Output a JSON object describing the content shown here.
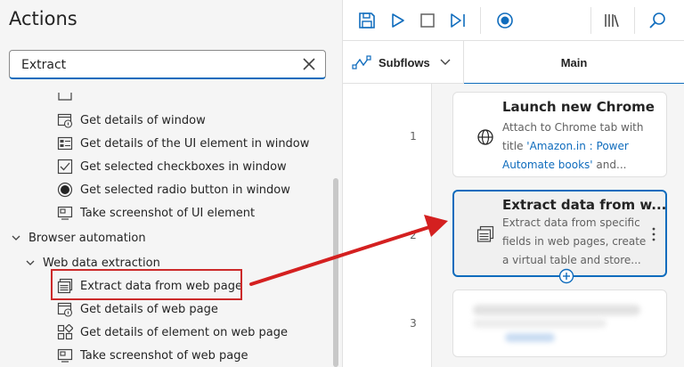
{
  "actions": {
    "title": "Actions",
    "search_value": "Extract",
    "items": [
      {
        "label": "Get details of window",
        "icon": "window-info-icon"
      },
      {
        "label": "Get details of the UI element in window",
        "icon": "ui-element-details-icon"
      },
      {
        "label": "Get selected checkboxes in window",
        "icon": "checkbox-icon"
      },
      {
        "label": "Get selected radio button in window",
        "icon": "radio-button-icon"
      },
      {
        "label": "Take screenshot of UI element",
        "icon": "screenshot-icon"
      }
    ],
    "group": "Browser automation",
    "subgroup": "Web data extraction",
    "sub_items": [
      {
        "label": "Extract data from web page",
        "icon": "extract-data-icon"
      },
      {
        "label": "Get details of web page",
        "icon": "web-page-info-icon"
      },
      {
        "label": "Get details of element on web page",
        "icon": "element-details-icon"
      },
      {
        "label": "Take screenshot of web page",
        "icon": "screenshot-icon"
      }
    ]
  },
  "toolbar": {
    "icons": [
      "save-icon",
      "run-icon",
      "stop-icon",
      "run-next-action-icon",
      "record-icon",
      "variables-icon",
      "search-icon"
    ]
  },
  "tabs": {
    "subflows_label": "Subflows",
    "main_label": "Main"
  },
  "flow": {
    "steps": [
      {
        "number": "1",
        "title": "Launch new Chrome",
        "desc_prefix": "Attach to Chrome tab with title ",
        "desc_link": "'Amazon.in : Power Automate books'",
        "desc_suffix": " and..."
      },
      {
        "number": "2",
        "title": "Extract data from w...",
        "desc": "Extract data from specific fields in web pages, create a virtual table and store..."
      },
      {
        "number": "3"
      }
    ]
  },
  "colors": {
    "accent": "#0f6cbd",
    "annotation": "#cc2a2a"
  }
}
